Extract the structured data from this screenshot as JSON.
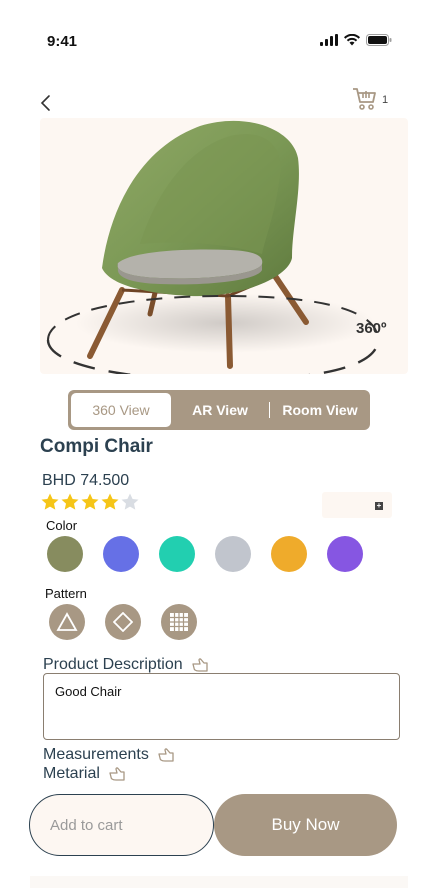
{
  "status_bar": {
    "time": "9:41"
  },
  "header": {
    "cart_count": "1"
  },
  "hero": {
    "rotation_label": "360º"
  },
  "view_tabs": [
    {
      "label": "360 View"
    },
    {
      "label": "AR View"
    },
    {
      "label": "Room View"
    }
  ],
  "product": {
    "name": "Compi Chair",
    "price": "BHD 74.500",
    "rating": 4,
    "rating_max": 5
  },
  "colors": {
    "label": "Color",
    "swatches": [
      "#878c5f",
      "#6670e6",
      "#22cfb0",
      "#c1c5cd",
      "#efab2b",
      "#8656e2"
    ]
  },
  "patterns": {
    "label": "Pattern",
    "items": [
      "triangle-icon",
      "diamond-icon",
      "grid-icon"
    ]
  },
  "sections": {
    "description_title": "Product Description",
    "description_text": "Good Chair",
    "measurements_title": "Measurements",
    "material_title": "Metarial"
  },
  "actions": {
    "add_to_cart": "Add to cart",
    "buy_now": "Buy Now"
  },
  "theme": {
    "accent": "#a89884",
    "text": "#2c4150",
    "star": "#f5c518",
    "star_empty": "#d9dde3"
  }
}
